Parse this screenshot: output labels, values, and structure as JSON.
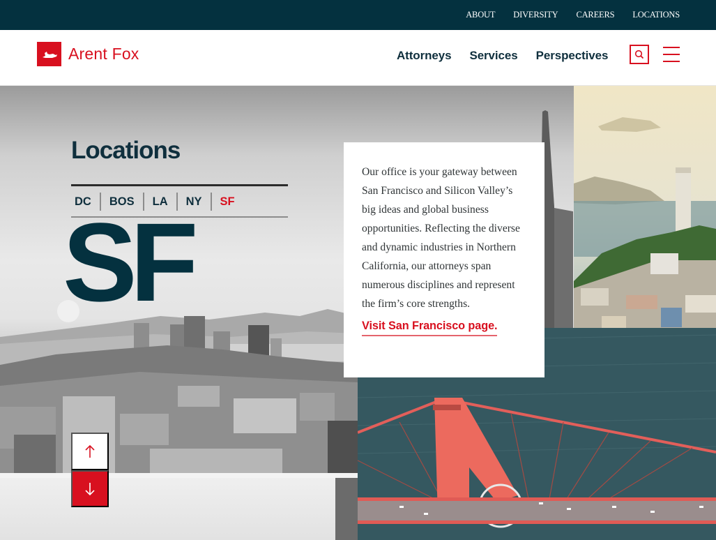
{
  "utility_nav": {
    "items": [
      {
        "label": "ABOUT"
      },
      {
        "label": "DIVERSITY"
      },
      {
        "label": "CAREERS"
      },
      {
        "label": "LOCATIONS"
      }
    ]
  },
  "header": {
    "logo_text": "Arent Fox",
    "logo_icon": "fox-icon",
    "nav": [
      {
        "label": "Attorneys"
      },
      {
        "label": "Services"
      },
      {
        "label": "Perspectives"
      }
    ],
    "search_icon": "search-icon",
    "menu_icon": "hamburger-menu-icon"
  },
  "colors": {
    "brand_red": "#d8101f",
    "navy": "#04313f",
    "text_dark": "#0f2f3d"
  },
  "hero": {
    "title": "Locations",
    "tabs": [
      {
        "label": "DC",
        "active": false
      },
      {
        "label": "BOS",
        "active": false
      },
      {
        "label": "LA",
        "active": false
      },
      {
        "label": "NY",
        "active": false
      },
      {
        "label": "SF",
        "active": true
      }
    ],
    "big_city_code": "SF",
    "card": {
      "description": "Our office is your gateway between San Francisco and Silicon Valley’s big ideas and global business opportunities. Reflecting the diverse and dynamic industries in Northern California, our attorneys span numerous disciplines and represent the firm’s core strengths.",
      "link_label": "Visit San Francisco page."
    },
    "images": {
      "skyline": "San Francisco skyline (black and white)",
      "coit_tower": "Coit Tower and Alcatraz view",
      "bridge": "Golden Gate Bridge aerial view"
    }
  },
  "scroll_controls": {
    "up_icon": "arrow-up-icon",
    "down_icon": "arrow-down-icon"
  }
}
